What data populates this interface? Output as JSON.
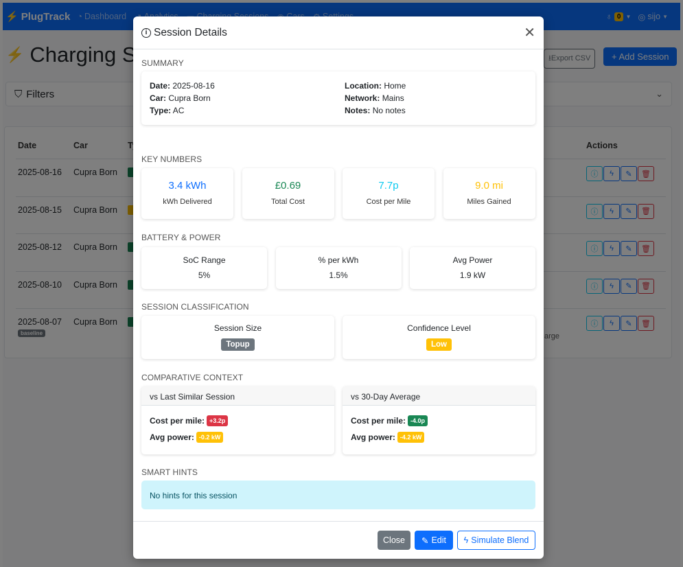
{
  "app": {
    "brand": "PlugTrack",
    "nav": [
      "Dashboard",
      "Analytics",
      "Charging Sessions",
      "Cars",
      "Settings"
    ],
    "hint_count": "0",
    "user": "sijo"
  },
  "page": {
    "title": "Charging Se",
    "export_label": "Export CSV",
    "add_label": "+ Add Session",
    "filters_label": "Filters",
    "table": {
      "headers": {
        "date": "Date",
        "car": "Car",
        "type": "Ty",
        "actions": "Actions"
      },
      "rows": [
        {
          "date": "2025-08-16",
          "car": "Cupra Born",
          "type_color": "#198754",
          "badge": "",
          "note": ""
        },
        {
          "date": "2025-08-15",
          "car": "Cupra Born",
          "type_color": "#ffc107",
          "badge": "",
          "note": ""
        },
        {
          "date": "2025-08-12",
          "car": "Cupra Born",
          "type_color": "#198754",
          "badge": "",
          "note": ""
        },
        {
          "date": "2025-08-10",
          "car": "Cupra Born",
          "type_color": "#198754",
          "badge": "",
          "note": ""
        },
        {
          "date": "2025-08-07",
          "car": "Cupra Born",
          "type_color": "#198754",
          "badge": "baseline",
          "note": "arge"
        }
      ]
    }
  },
  "modal": {
    "title": "Session Details",
    "summary": {
      "label": "SUMMARY",
      "date_key": "Date:",
      "date": "2025-08-16",
      "car_key": "Car:",
      "car": "Cupra Born",
      "type_key": "Type:",
      "type": "AC",
      "location_key": "Location:",
      "location": "Home",
      "network_key": "Network:",
      "network": "Mains",
      "notes_key": "Notes:",
      "notes": "No notes"
    },
    "key_numbers": {
      "label": "KEY NUMBERS",
      "items": [
        {
          "value": "3.4 kWh",
          "label": "kWh Delivered",
          "color": "#0d6efd"
        },
        {
          "value": "£0.69",
          "label": "Total Cost",
          "color": "#198754"
        },
        {
          "value": "7.7p",
          "label": "Cost per Mile",
          "color": "#0dcaf0"
        },
        {
          "value": "9.0 mi",
          "label": "Miles Gained",
          "color": "#ffc107"
        }
      ]
    },
    "battery": {
      "label": "BATTERY & POWER",
      "items": [
        {
          "label": "SoC Range",
          "value": "5%"
        },
        {
          "label": "% per kWh",
          "value": "1.5%"
        },
        {
          "label": "Avg Power",
          "value": "1.9 kW"
        }
      ]
    },
    "classification": {
      "label": "SESSION CLASSIFICATION",
      "size_label": "Session Size",
      "size_value": "Topup",
      "size_color": "#6c757d",
      "confidence_label": "Confidence Level",
      "confidence_value": "Low",
      "confidence_color": "#ffc107"
    },
    "comparative": {
      "label": "COMPARATIVE CONTEXT",
      "last": {
        "title": "vs Last Similar Session",
        "cost_key": "Cost per mile:",
        "cost": "+3.2p",
        "cost_color": "#dc3545",
        "power_key": "Avg power:",
        "power": "-0.2 kW",
        "power_color": "#ffc107"
      },
      "avg30": {
        "title": "vs 30-Day Average",
        "cost_key": "Cost per mile:",
        "cost": "-4.0p",
        "cost_color": "#198754",
        "power_key": "Avg power:",
        "power": "-4.2 kW",
        "power_color": "#ffc107"
      }
    },
    "hints": {
      "label": "SMART HINTS",
      "text": "No hints for this session"
    },
    "footer": {
      "close": "Close",
      "edit": "Edit",
      "simulate": "Simulate Blend"
    }
  }
}
